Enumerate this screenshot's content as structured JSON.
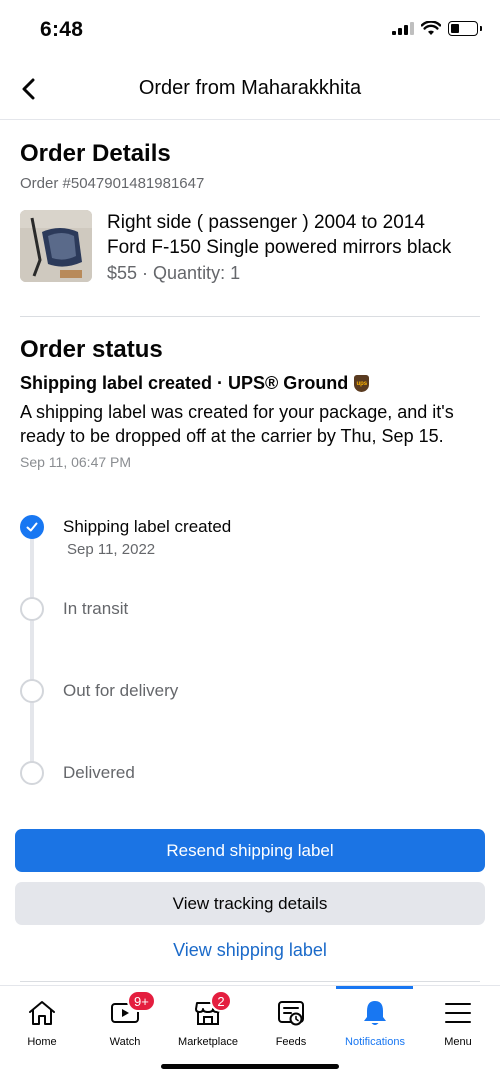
{
  "status_bar": {
    "time": "6:48"
  },
  "header": {
    "title": "Order from Maharakkhita"
  },
  "order_details": {
    "heading": "Order Details",
    "order_number": "Order #5047901481981647",
    "product": {
      "title_line1": "Right side ( passenger ) 2004 to 2014",
      "title_line2": "Ford F-150 Single powered mirrors black",
      "meta": "$55 · Quantity: 1"
    }
  },
  "order_status": {
    "heading": "Order status",
    "carrier_line": "Shipping label created · UPS® Ground",
    "description": "A shipping label was created for your package, and it's ready to be dropped off at the carrier by Thu, Sep 15.",
    "timestamp": "Sep 11, 06:47 PM",
    "steps": [
      {
        "label": "Shipping label created",
        "date": "Sep 11, 2022",
        "done": true
      },
      {
        "label": "In transit",
        "done": false
      },
      {
        "label": "Out for delivery",
        "done": false
      },
      {
        "label": "Delivered",
        "done": false
      }
    ]
  },
  "actions": {
    "resend_label": "Resend shipping label",
    "view_tracking": "View tracking details",
    "view_label": "View shipping label"
  },
  "tabbar": {
    "active": "Notifications",
    "tabs": [
      {
        "label": "Home",
        "icon": "home-icon"
      },
      {
        "label": "Watch",
        "icon": "watch-icon",
        "badge": "9+"
      },
      {
        "label": "Marketplace",
        "icon": "marketplace-icon",
        "badge": "2"
      },
      {
        "label": "Feeds",
        "icon": "feeds-icon"
      },
      {
        "label": "Notifications",
        "icon": "bell-icon"
      },
      {
        "label": "Menu",
        "icon": "menu-icon"
      }
    ]
  },
  "colors": {
    "accent": "#1877f2",
    "badge": "#e41e3f",
    "secondary_text": "#65676b"
  }
}
